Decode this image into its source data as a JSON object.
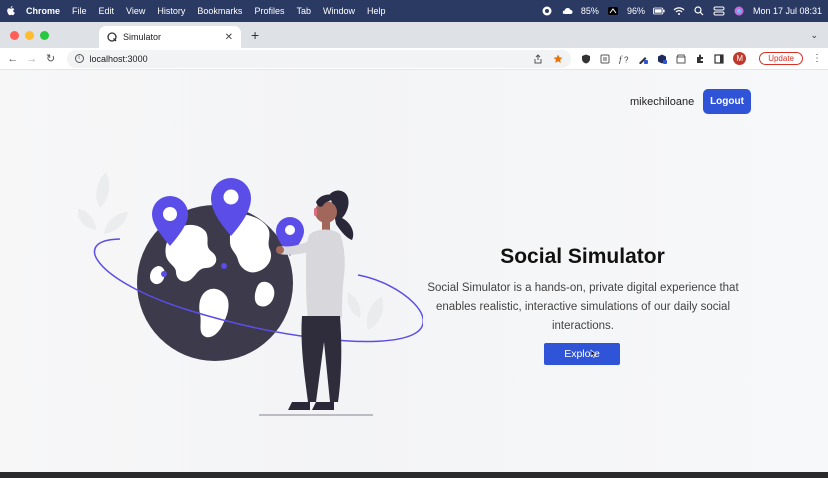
{
  "menubar": {
    "app": "Chrome",
    "items": [
      "File",
      "Edit",
      "View",
      "History",
      "Bookmarks",
      "Profiles",
      "Tab",
      "Window",
      "Help"
    ],
    "status": {
      "cpu": "85%",
      "battery": "96%",
      "datetime": "Mon 17 Jul  08:31"
    }
  },
  "browser": {
    "tab_title": "Simulator",
    "url": "localhost:3000",
    "profile_initial": "M",
    "update_label": "Update"
  },
  "header": {
    "username": "mikechiloane",
    "logout_label": "Logout"
  },
  "hero": {
    "title": "Social Simulator",
    "description": "Social Simulator is a hands-on, private digital experience that enables realistic, interactive simulations of our daily social interactions.",
    "explore_label": "Explore"
  },
  "colors": {
    "accent": "#2f54d8",
    "illustration_purple": "#5b4ee8",
    "globe_dark": "#3d3a4b",
    "menubar_bg": "#2b3a63"
  },
  "icons": [
    "apple-icon",
    "record-icon",
    "cloud-icon",
    "cpu-icon",
    "battery-icon",
    "wifi-icon",
    "search-icon",
    "control-center-icon",
    "siri-icon",
    "share-icon",
    "star-icon",
    "extension-icon",
    "cursor-icon"
  ]
}
